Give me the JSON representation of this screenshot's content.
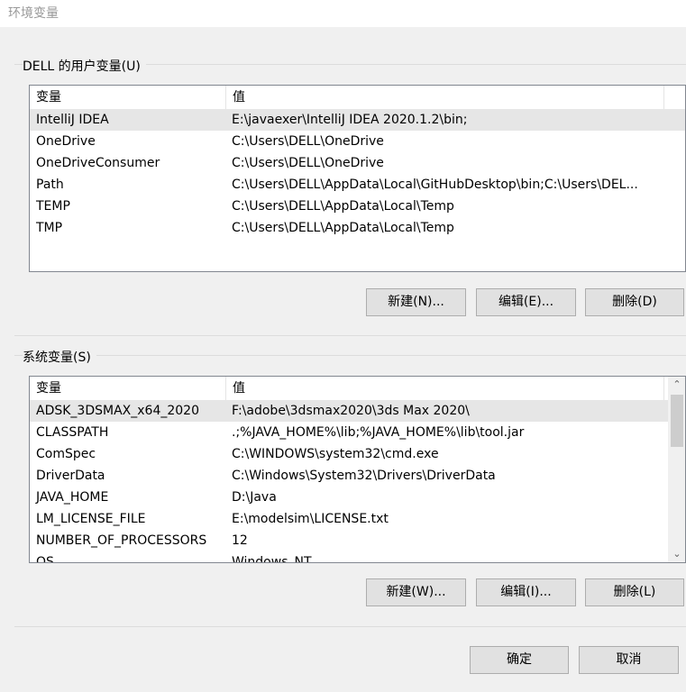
{
  "window": {
    "title": "环境变量"
  },
  "user_vars": {
    "group_label": "DELL 的用户变量(U)",
    "columns": [
      "变量",
      "值"
    ],
    "rows": [
      [
        "IntelliJ IDEA",
        "E:\\javaexer\\IntelliJ IDEA 2020.1.2\\bin;"
      ],
      [
        "OneDrive",
        "C:\\Users\\DELL\\OneDrive"
      ],
      [
        "OneDriveConsumer",
        "C:\\Users\\DELL\\OneDrive"
      ],
      [
        "Path",
        "C:\\Users\\DELL\\AppData\\Local\\GitHubDesktop\\bin;C:\\Users\\DEL..."
      ],
      [
        "TEMP",
        "C:\\Users\\DELL\\AppData\\Local\\Temp"
      ],
      [
        "TMP",
        "C:\\Users\\DELL\\AppData\\Local\\Temp"
      ]
    ],
    "selected_index": 0,
    "buttons": {
      "new": "新建(N)...",
      "edit": "编辑(E)...",
      "delete": "删除(D)"
    }
  },
  "system_vars": {
    "group_label": "系统变量(S)",
    "columns": [
      "变量",
      "值"
    ],
    "rows": [
      [
        "ADSK_3DSMAX_x64_2020",
        "F:\\adobe\\3dsmax2020\\3ds Max 2020\\"
      ],
      [
        "CLASSPATH",
        ".;%JAVA_HOME%\\lib;%JAVA_HOME%\\lib\\tool.jar"
      ],
      [
        "ComSpec",
        "C:\\WINDOWS\\system32\\cmd.exe"
      ],
      [
        "DriverData",
        "C:\\Windows\\System32\\Drivers\\DriverData"
      ],
      [
        "JAVA_HOME",
        "D:\\Java"
      ],
      [
        "LM_LICENSE_FILE",
        "E:\\modelsim\\LICENSE.txt"
      ],
      [
        "NUMBER_OF_PROCESSORS",
        "12"
      ],
      [
        "OS",
        "Windows_NT"
      ]
    ],
    "selected_index": 0,
    "buttons": {
      "new": "新建(W)...",
      "edit": "编辑(I)...",
      "delete": "删除(L)"
    }
  },
  "footer": {
    "ok": "确定",
    "cancel": "取消"
  },
  "colors": {
    "selected_row": "#e6e6e6",
    "button_face": "#e1e1e1",
    "border": "#adadad"
  }
}
